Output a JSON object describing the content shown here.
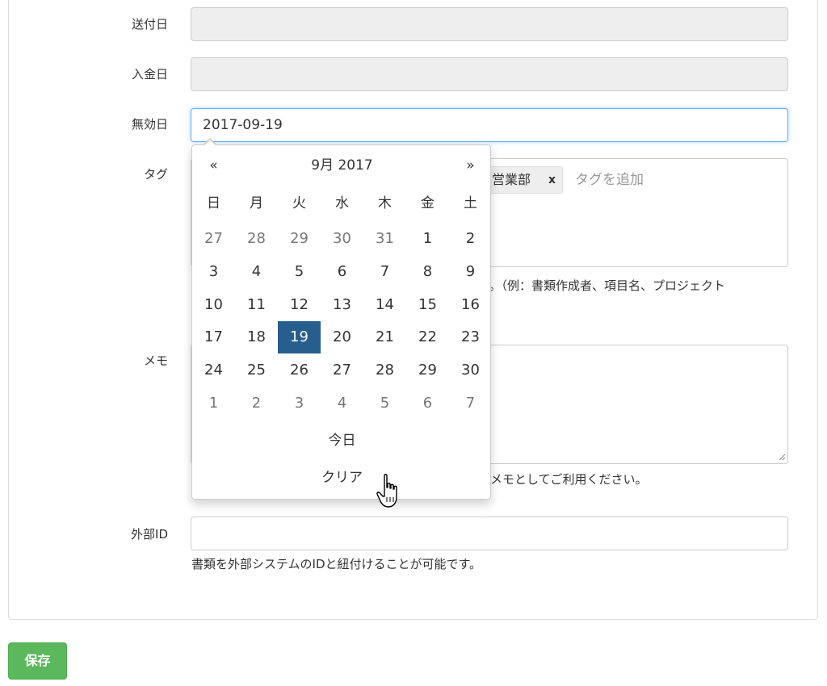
{
  "form": {
    "sent_date": {
      "label": "送付日",
      "value": ""
    },
    "payment_date": {
      "label": "入金日",
      "value": ""
    },
    "invalid_date": {
      "label": "無効日",
      "value": "2017-09-19"
    },
    "tags": {
      "label": "タグ",
      "items": [
        {
          "text": "営業部",
          "remove": "x"
        }
      ],
      "placeholder": "タグを追加",
      "help": "す。（例：書類作成者、項目名、プロジェクト"
    },
    "memo": {
      "label": "メモ",
      "help": "メモとしてご利用ください。"
    },
    "external_id": {
      "label": "外部ID",
      "value": "",
      "help": "書類を外部システムのIDと紐付けることが可能です。"
    }
  },
  "datepicker": {
    "prev": "«",
    "next": "»",
    "month_title": "9月 2017",
    "weekdays": [
      "日",
      "月",
      "火",
      "水",
      "木",
      "金",
      "土"
    ],
    "weeks": [
      [
        "27",
        "28",
        "29",
        "30",
        "31",
        "1",
        "2"
      ],
      [
        "3",
        "4",
        "5",
        "6",
        "7",
        "8",
        "9"
      ],
      [
        "10",
        "11",
        "12",
        "13",
        "14",
        "15",
        "16"
      ],
      [
        "17",
        "18",
        "19",
        "20",
        "21",
        "22",
        "23"
      ],
      [
        "24",
        "25",
        "26",
        "27",
        "28",
        "29",
        "30"
      ],
      [
        "1",
        "2",
        "3",
        "4",
        "5",
        "6",
        "7"
      ]
    ],
    "selected": "19",
    "today_label": "今日",
    "clear_label": "クリア"
  },
  "actions": {
    "save_label": "保存"
  },
  "colors": {
    "selected_day": "#285e8e",
    "save_button": "#5cb85c",
    "focus_border": "#66afe9"
  }
}
